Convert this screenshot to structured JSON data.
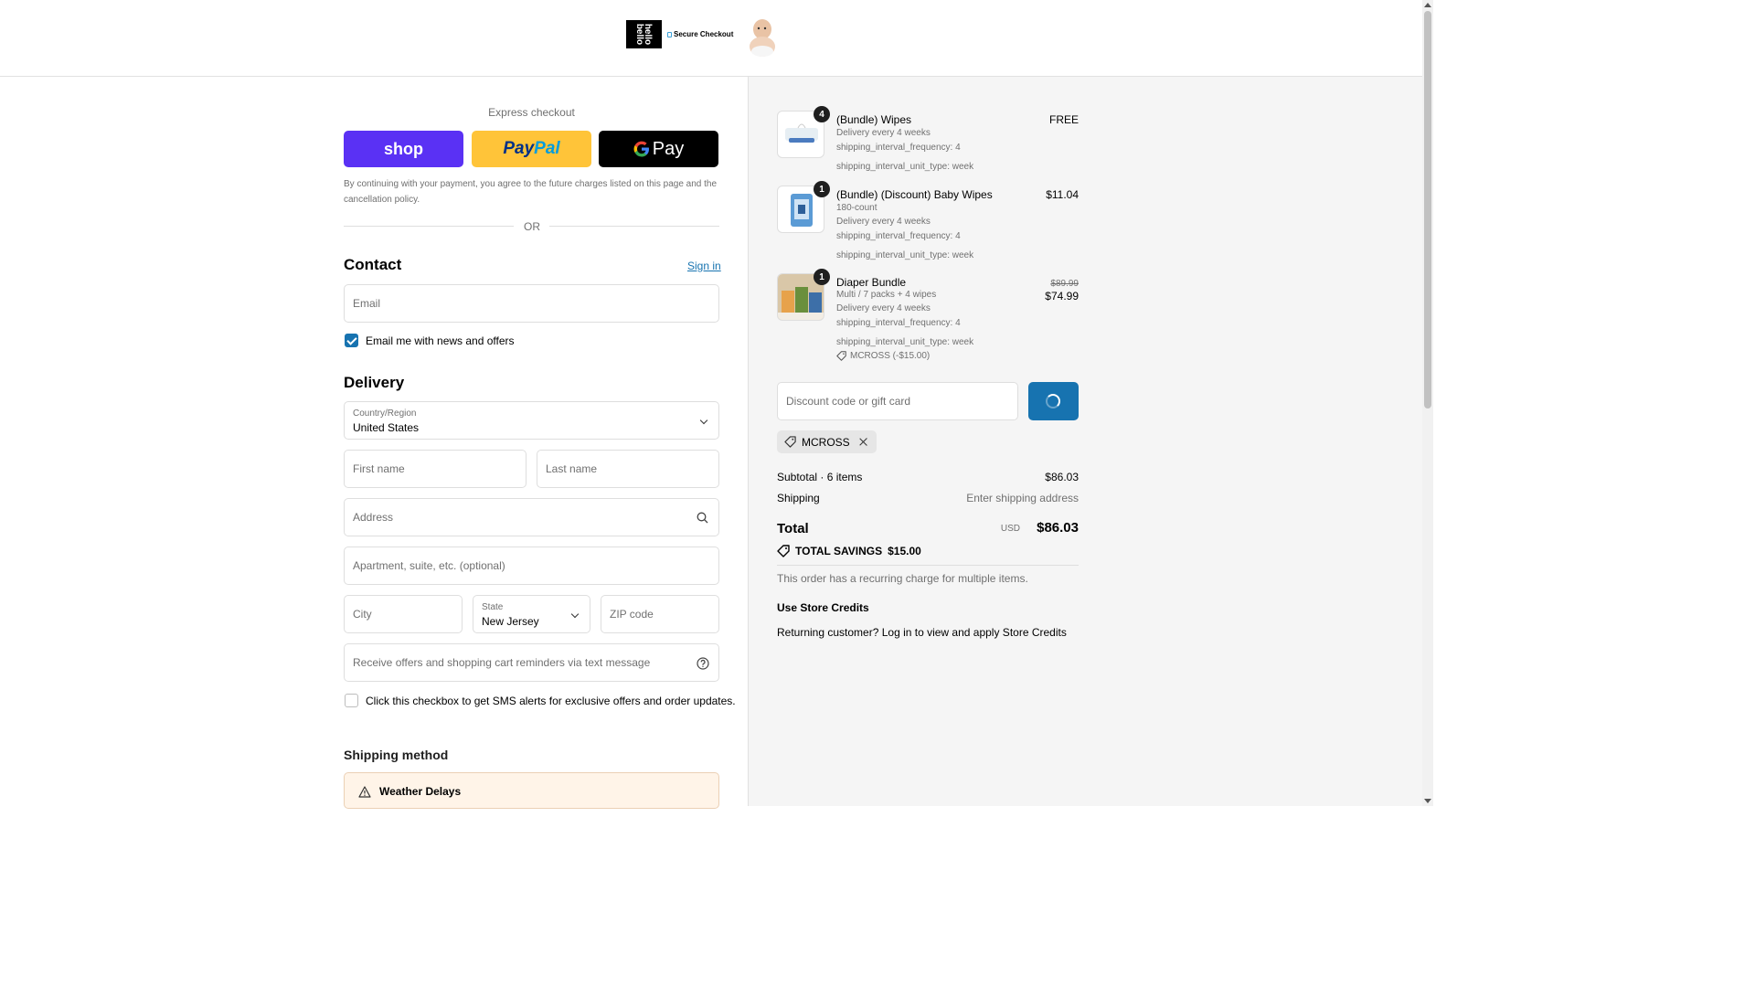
{
  "header": {
    "logo_text": "hello bello",
    "secure_checkout": "Secure Checkout"
  },
  "express": {
    "title": "Express checkout",
    "shop_label": "shop",
    "paypal_label_1": "Pay",
    "paypal_label_2": "Pal",
    "gpay_label": "Pay",
    "legal": "By continuing with your payment, you agree to the future charges listed on this page and the cancellation policy.",
    "or": "OR"
  },
  "contact": {
    "heading": "Contact",
    "sign_in": "Sign in",
    "email_placeholder": "Email",
    "news_label": "Email me with news and offers",
    "news_checked": true
  },
  "delivery": {
    "heading": "Delivery",
    "country_label": "Country/Region",
    "country_value": "United States",
    "first_name_ph": "First name",
    "last_name_ph": "Last name",
    "address_ph": "Address",
    "apartment_ph": "Apartment, suite, etc. (optional)",
    "city_ph": "City",
    "state_label": "State",
    "state_value": "New Jersey",
    "zip_ph": "ZIP code",
    "sms_ph": "Receive offers and shopping cart reminders via text message",
    "sms_checkbox_label": "Click this checkbox to get SMS alerts for exclusive offers and order updates.",
    "sms_checked": false
  },
  "shipping_method": {
    "heading": "Shipping method",
    "notice_title": "Weather Delays"
  },
  "cart": {
    "items": [
      {
        "qty": "4",
        "name": "(Bundle) Wipes",
        "price": "FREE",
        "lines": [
          "Delivery every 4 weeks",
          "shipping_interval_frequency: 4",
          "shipping_interval_unit_type: week"
        ]
      },
      {
        "qty": "1",
        "name": "(Bundle) (Discount) Baby Wipes",
        "price": "$11.04",
        "lines": [
          "180-count",
          "Delivery every 4 weeks",
          "shipping_interval_frequency: 4",
          "shipping_interval_unit_type: week"
        ]
      },
      {
        "qty": "1",
        "name": "Diaper Bundle",
        "original_price": "$89.99",
        "price": "$74.99",
        "lines": [
          "Multi / 7 packs + 4 wipes",
          "Delivery every 4 weeks",
          "shipping_interval_frequency: 4",
          "shipping_interval_unit_type: week"
        ],
        "discount": "MCROSS (-$15.00)"
      }
    ],
    "discount_placeholder": "Discount code or gift card",
    "applied_code": "MCROSS",
    "subtotal_label": "Subtotal · 6 items",
    "subtotal_value": "$86.03",
    "shipping_label": "Shipping",
    "shipping_value": "Enter shipping address",
    "total_label": "Total",
    "currency": "USD",
    "total_value": "$86.03",
    "savings_label": "TOTAL SAVINGS",
    "savings_value": "$15.00",
    "recurring_note": "This order has a recurring charge for multiple items.",
    "credits_heading": "Use Store Credits",
    "credits_text": "Returning customer? Log in to view and apply Store Credits"
  }
}
